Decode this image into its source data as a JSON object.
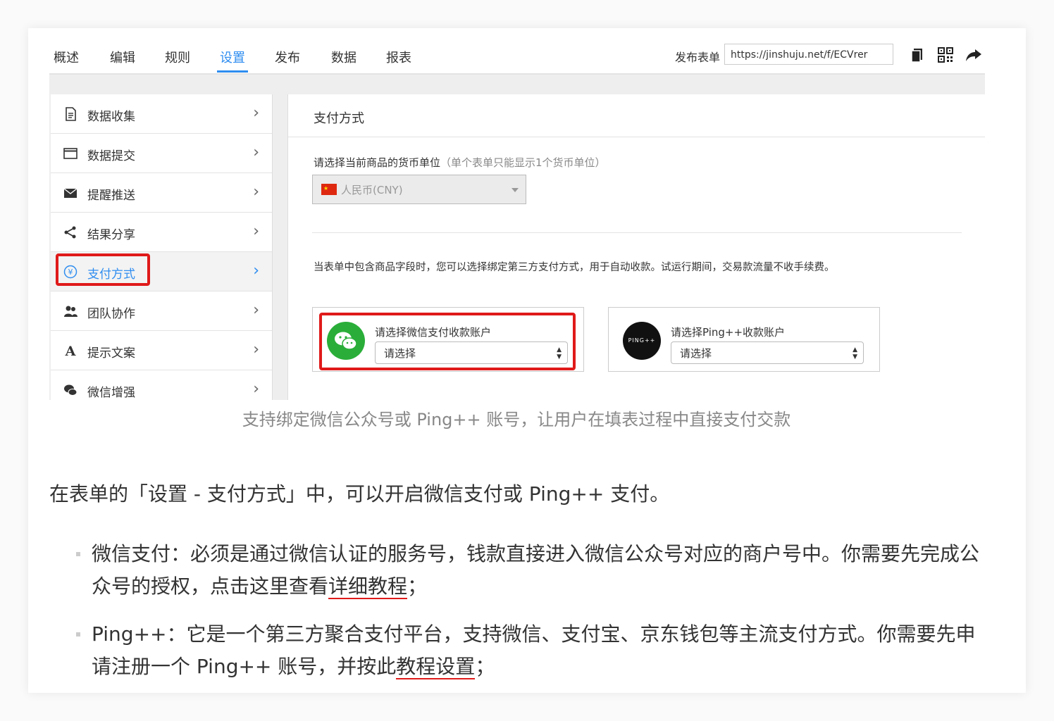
{
  "nav": {
    "tabs": [
      "概述",
      "编辑",
      "规则",
      "设置",
      "发布",
      "数据",
      "报表"
    ],
    "active_tab": "设置",
    "publish_label": "发布表单",
    "publish_url": "https://jinshuju.net/f/ECVrer",
    "icons": [
      "copy-icon",
      "qrcode-icon",
      "share-icon"
    ]
  },
  "sidebar": {
    "items": [
      {
        "label": "数据收集",
        "icon": "document-icon"
      },
      {
        "label": "数据提交",
        "icon": "window-icon"
      },
      {
        "label": "提醒推送",
        "icon": "envelope-icon"
      },
      {
        "label": "结果分享",
        "icon": "share-nodes-icon"
      },
      {
        "label": "支付方式",
        "icon": "yen-icon"
      },
      {
        "label": "团队协作",
        "icon": "users-icon"
      },
      {
        "label": "提示文案",
        "icon": "letter-a-icon"
      },
      {
        "label": "微信增强",
        "icon": "wechat-icon"
      }
    ],
    "active_item": "支付方式",
    "chevron": "›"
  },
  "main": {
    "title": "支付方式",
    "currency_label": "请选择当前商品的货币单位",
    "currency_note": "（单个表单只能显示1个货币单位）",
    "currency_value": "人民币(CNY)",
    "description": "当表单中包含商品字段时，您可以选择绑定第三方支付方式，用于自动收款。试运行期间，交易款流量不收手续费。",
    "wechat": {
      "title": "请选择微信支付收款账户",
      "select": "请选择"
    },
    "ping": {
      "title": "请选择Ping++收款账户",
      "select": "请选择",
      "logo_text": "PING++"
    }
  },
  "article": {
    "caption": "支持绑定微信公众号或 Ping++ 账号，让用户在填表过程中直接支付交款",
    "intro": "在表单的「设置 - 支付方式」中，可以开启微信支付或 Ping++ 支付。",
    "bullet1_a": "微信支付：必须是通过微信认证的服务号，钱款直接进入微信公众号对应的商户号中。你需要先完成公众号的授权，点击这里查看",
    "bullet1_link": "详细教程",
    "bullet1_end": "；",
    "bullet2_a": "Ping++：它是一个第三方聚合支付平台，支持微信、支付宝、京东钱包等主流支付方式。你需要先申请注册一个 Ping++ 账号，并按此",
    "bullet2_link": "教程设置",
    "bullet2_end": "；"
  },
  "colors": {
    "accent": "#2f8df0",
    "highlight": "#e01a1a",
    "wechat_green": "#2aae39"
  }
}
